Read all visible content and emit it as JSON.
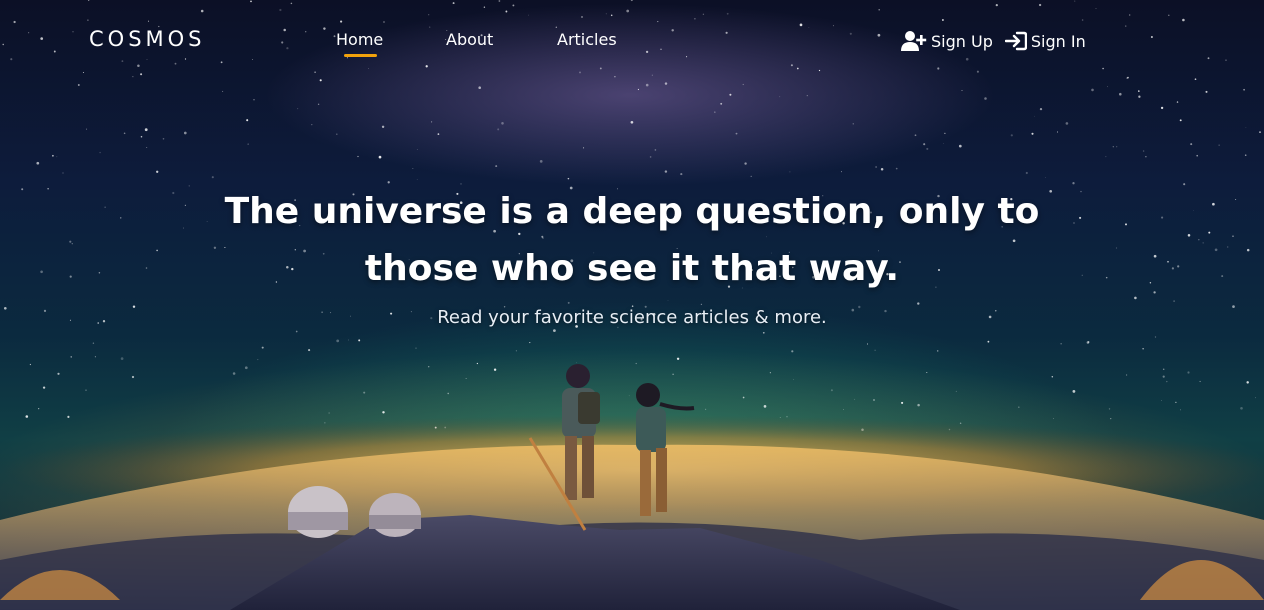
{
  "nav": {
    "brand": "COSMOS",
    "links": [
      {
        "label": "Home",
        "active": true
      },
      {
        "label": "About",
        "active": false
      },
      {
        "label": "Articles",
        "active": false
      }
    ],
    "sign_up": {
      "label": "Sign Up",
      "icon": "user-plus-icon"
    },
    "sign_in": {
      "label": "Sign In",
      "icon": "sign-in-icon"
    }
  },
  "hero": {
    "headline_line1": "The universe is a deep question, only to",
    "headline_line2": "those who see it that way.",
    "subline": "Read your favorite science articles & more."
  },
  "colors": {
    "accent": "#f2a20c",
    "text": "#ffffff",
    "sky_top": "#0c1026",
    "horizon_glow": "#ffbe46"
  }
}
